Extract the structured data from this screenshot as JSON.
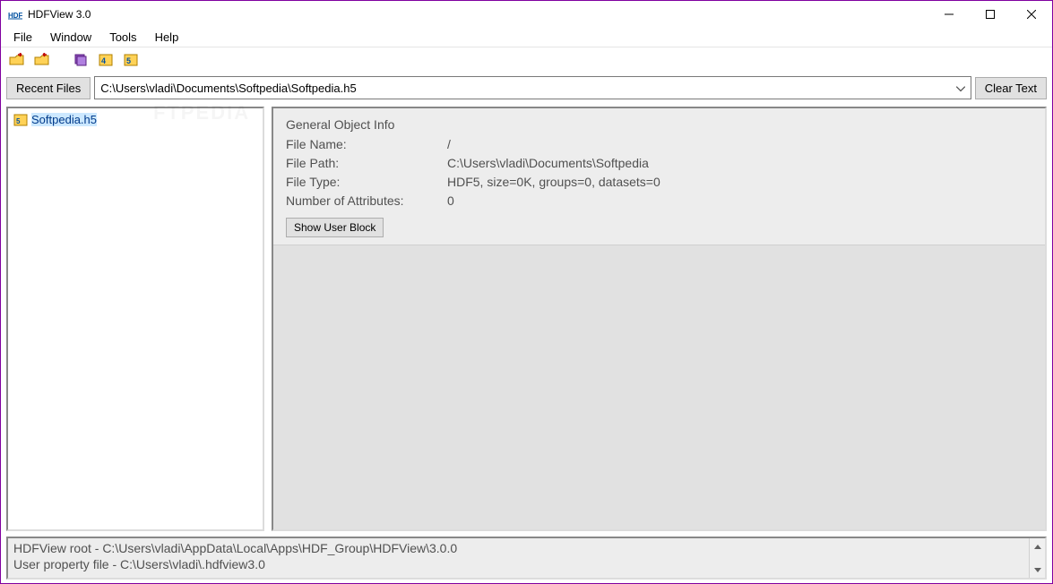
{
  "window": {
    "title": "HDFView 3.0"
  },
  "menu": {
    "file": "File",
    "window": "Window",
    "tools": "Tools",
    "help": "Help"
  },
  "pathbar": {
    "recent_label": "Recent Files",
    "path_value": "C:\\Users\\vladi\\Documents\\Softpedia\\Softpedia.h5",
    "clear_label": "Clear Text"
  },
  "tree": {
    "items": [
      {
        "label": "Softpedia.h5",
        "selected": true
      }
    ]
  },
  "info": {
    "heading": "General Object Info",
    "rows": {
      "file_name_label": "File Name:",
      "file_name_value": "/",
      "file_path_label": "File Path:",
      "file_path_value": "C:\\Users\\vladi\\Documents\\Softpedia",
      "file_type_label": "File Type:",
      "file_type_value": "HDF5, size=0K, groups=0, datasets=0",
      "num_attr_label": "Number of Attributes:",
      "num_attr_value": "0"
    },
    "show_user_block": "Show User Block"
  },
  "status": {
    "text": "HDFView root - C:\\Users\\vladi\\AppData\\Local\\Apps\\HDF_Group\\HDFView\\3.0.0\nUser property file - C:\\Users\\vladi\\.hdfview3.0"
  },
  "watermark": "FTPEDIA"
}
